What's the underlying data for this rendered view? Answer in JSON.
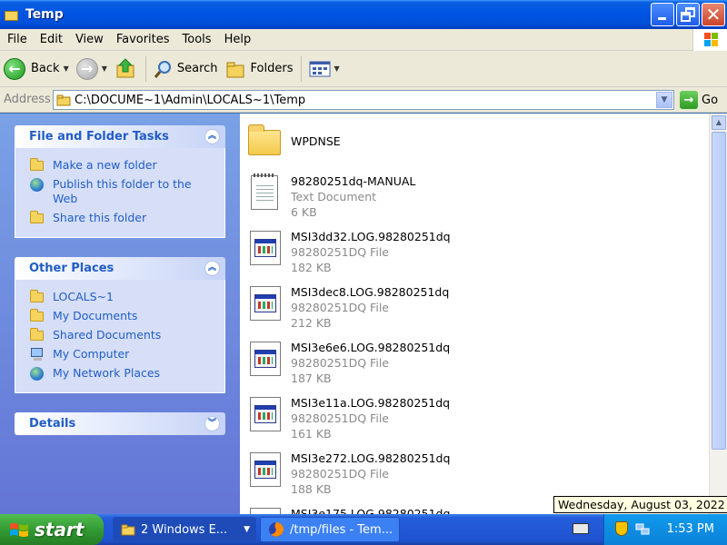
{
  "window": {
    "title": "Temp"
  },
  "menu": [
    "File",
    "Edit",
    "View",
    "Favorites",
    "Tools",
    "Help"
  ],
  "toolbar": {
    "back": "Back",
    "search": "Search",
    "folders": "Folders"
  },
  "address": {
    "label": "Address",
    "path": "C:\\DOCUME~1\\Admin\\LOCALS~1\\Temp",
    "go": "Go"
  },
  "taskpane": {
    "file_tasks": {
      "title": "File and Folder Tasks",
      "items": [
        "Make a new folder",
        "Publish this folder to the Web",
        "Share this folder"
      ]
    },
    "other_places": {
      "title": "Other Places",
      "items": [
        "LOCALS~1",
        "My Documents",
        "Shared Documents",
        "My Computer",
        "My Network Places"
      ]
    },
    "details": {
      "title": "Details"
    }
  },
  "files": [
    {
      "name": "WPDNSE",
      "type": "",
      "size": ""
    },
    {
      "name": "98280251dq-MANUAL",
      "type": "Text Document",
      "size": "6 KB"
    },
    {
      "name": "MSI3dd32.LOG.98280251dq",
      "type": "98280251DQ File",
      "size": "182 KB"
    },
    {
      "name": "MSI3dec8.LOG.98280251dq",
      "type": "98280251DQ File",
      "size": "212 KB"
    },
    {
      "name": "MSI3e6e6.LOG.98280251dq",
      "type": "98280251DQ File",
      "size": "187 KB"
    },
    {
      "name": "MSI3e11a.LOG.98280251dq",
      "type": "98280251DQ File",
      "size": "161 KB"
    },
    {
      "name": "MSI3e272.LOG.98280251dq",
      "type": "98280251DQ File",
      "size": "188 KB"
    },
    {
      "name": "MSI3e175.LOG.98280251dq",
      "type": "",
      "size": ""
    }
  ],
  "tooltip": "Wednesday, August 03, 2022",
  "taskbar": {
    "start": "start",
    "tasks": [
      "2 Windows E...",
      "/tmp/files - Tem..."
    ],
    "clock": "1:53 PM"
  }
}
